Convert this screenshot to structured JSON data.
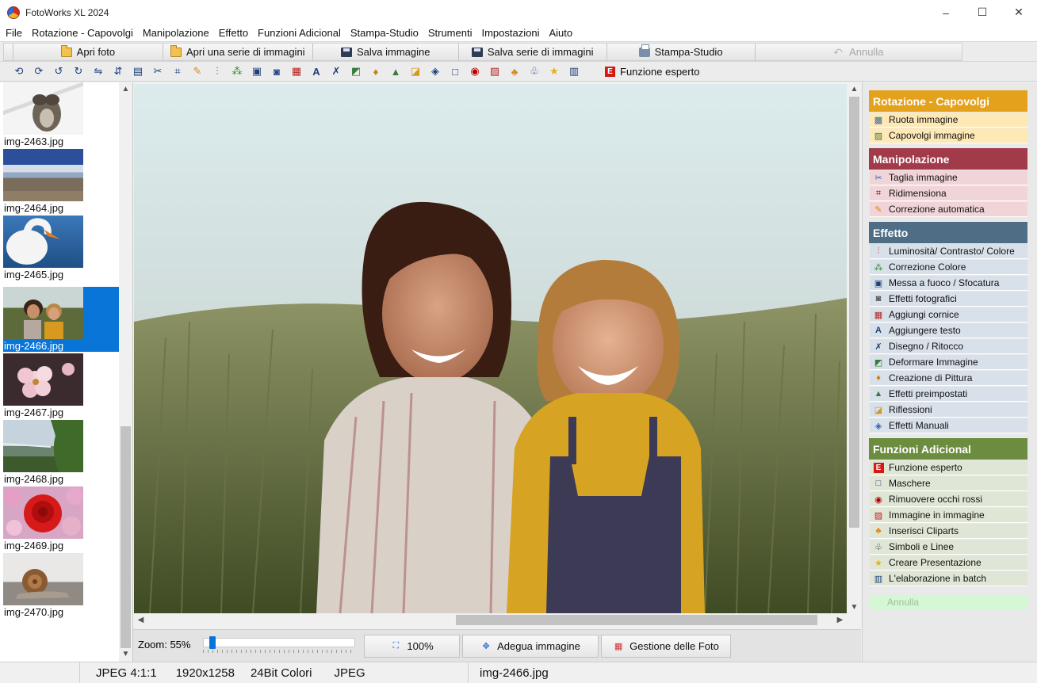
{
  "window": {
    "title": "FotoWorks XL 2024",
    "minimize": "–",
    "maximize": "☐",
    "close": "✕"
  },
  "menu": [
    "File",
    "Rotazione - Capovolgi",
    "Manipolazione",
    "Effetto",
    "Funzioni Adicional",
    "Stampa-Studio",
    "Strumenti",
    "Impostazioni",
    "Aiuto"
  ],
  "toolbar1": {
    "open_photo": "Apri foto",
    "open_series": "Apri una serie di immagini",
    "save_image": "Salva immagine",
    "save_series": "Salva serie di immagini",
    "print_studio": "Stampa-Studio",
    "undo": "Annulla"
  },
  "toolbar2": {
    "expert_label": "Funzione esperto",
    "expert_icon": "E"
  },
  "thumbnails": [
    {
      "file": "img-2463.jpg",
      "selected": false
    },
    {
      "file": "img-2464.jpg",
      "selected": false
    },
    {
      "file": "img-2465.jpg",
      "selected": false
    },
    {
      "file": "img-2466.jpg",
      "selected": true
    },
    {
      "file": "img-2467.jpg",
      "selected": false
    },
    {
      "file": "img-2468.jpg",
      "selected": false
    },
    {
      "file": "img-2469.jpg",
      "selected": false
    },
    {
      "file": "img-2470.jpg",
      "selected": false
    }
  ],
  "zoom": {
    "label": "Zoom: 55%",
    "value_percent": 55,
    "btn_100": "100%",
    "btn_fit": "Adegua immagine",
    "btn_manage": "Gestione delle Foto"
  },
  "right_panel": {
    "sections": [
      {
        "title": "Rotazione - Capovolgi",
        "color": "#e4a11b",
        "items": [
          "Ruota immagine",
          "Capovolgi immagine"
        ],
        "item_bg": "#fde8b6"
      },
      {
        "title": "Manipolazione",
        "color": "#a13b49",
        "items": [
          "Taglia immagine",
          "Ridimensiona",
          "Correzione automatica"
        ],
        "item_bg": "#f1d4d7"
      },
      {
        "title": "Effetto",
        "color": "#4f6e85",
        "items": [
          "Luminosità/ Contrasto/ Colore",
          "Correzione Colore",
          "Messa a fuoco / Sfocatura",
          "Effetti fotografici",
          "Aggiungi cornice",
          "Aggiungere testo",
          "Disegno / Ritocco",
          "Deformare Immagine",
          "Creazione di Pittura",
          "Effetti preimpostati",
          "Riflessioni",
          "Effetti Manuali"
        ],
        "item_bg": "#d8e1e9"
      },
      {
        "title": "Funzioni Adicional",
        "color": "#6c8c3f",
        "items": [
          "Funzione esperto",
          "Maschere",
          "Rimuovere occhi rossi",
          "Immagine in immagine",
          "Inserisci Cliparts",
          "Simboli e Linee",
          "Creare Presentazione",
          "L'elaborazione in batch"
        ],
        "item_bg": "#dfe6d6"
      }
    ],
    "undo": "Annulla"
  },
  "status": {
    "format": "JPEG  4:1:1",
    "size": "1920x1258",
    "colors": "24Bit Colori",
    "type": "JPEG",
    "filename": "img-2466.jpg"
  }
}
